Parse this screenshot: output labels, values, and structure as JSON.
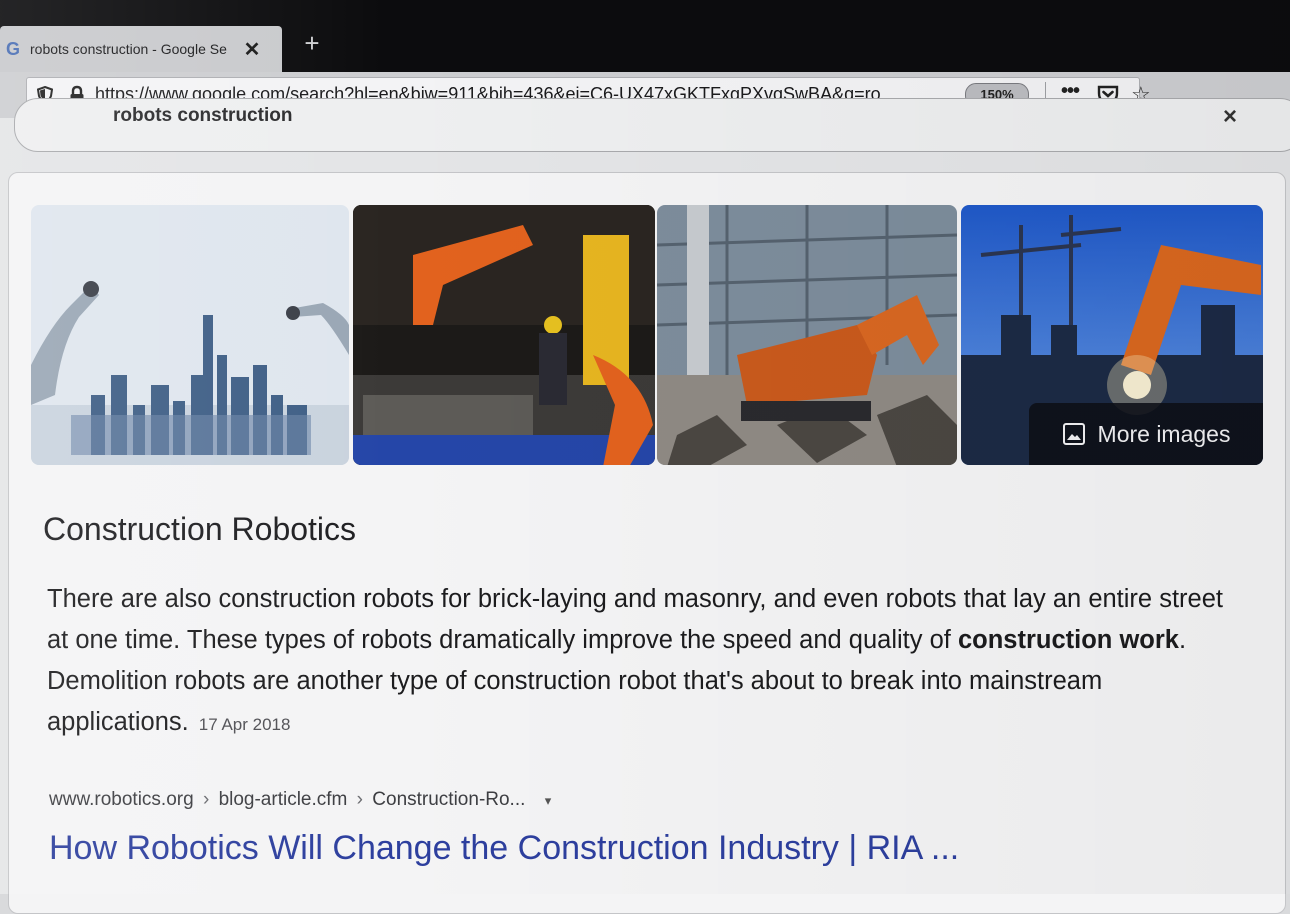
{
  "browser": {
    "tab_title": "robots construction - Google Se",
    "tab_favicon": "G",
    "tab_close": "✕",
    "new_tab": "+",
    "url": "https://www.google.com/search?hl=en&biw=911&bih=436&ei=C6-UX47xGKTFxgPXvqSwBA&q=ro",
    "zoom": "150%",
    "more_menu": "•••",
    "bookmark": "☆"
  },
  "search": {
    "query": "robots construction",
    "clear_icon": "×"
  },
  "images": {
    "more_images_label": "More images",
    "thumbnails": [
      {
        "icon": "robot-city-skyline-image"
      },
      {
        "icon": "orange-robot-arm-worker-image"
      },
      {
        "icon": "demolition-robot-rubble-image"
      },
      {
        "icon": "welding-robot-cranes-image"
      }
    ]
  },
  "knowledge": {
    "title": "Construction Robotics",
    "snippet_part1": "There are also construction robots for brick-laying and masonry, and even robots that lay an entire street at one time. These types of robots dramatically improve the speed and quality of ",
    "snippet_bold": "construction work",
    "snippet_part2": ". Demolition robots are another type of construction robot that's about to break into mainstream applications.",
    "date": "17 Apr 2018"
  },
  "result": {
    "breadcrumb_domain": "www.robotics.org",
    "breadcrumb_sep": "›",
    "breadcrumb_path1": "blog-article.cfm",
    "breadcrumb_path2": "Construction-Ro...",
    "dropdown": "▾",
    "title": "How Robotics Will Change the Construction Industry | RIA ..."
  },
  "colors": {
    "link": "#2d3f9e",
    "overlay": "#0c0e16",
    "robot_orange": "#e2621e"
  }
}
